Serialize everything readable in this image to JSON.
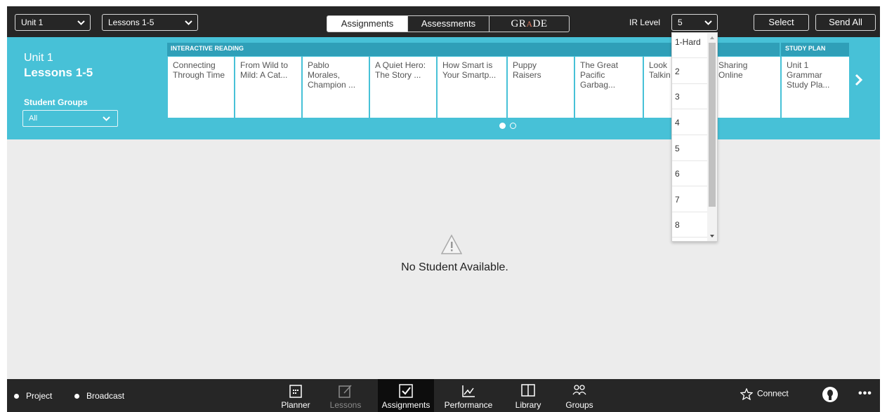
{
  "topbar": {
    "unit_select": "Unit 1",
    "lessons_select": "Lessons 1-5",
    "tabs": {
      "assignments": "Assignments",
      "assessments": "Assessments",
      "grade_pre": "GR",
      "grade_a": "A",
      "grade_post": "DE"
    },
    "ir_label": "IR Level",
    "ir_value": "5",
    "select_button": "Select",
    "send_all_button": "Send All"
  },
  "band": {
    "unit_title": "Unit 1",
    "lessons_title": "Lessons 1-5",
    "student_groups_label": "Student Groups",
    "student_groups_value": "All",
    "section_interactive": "INTERACTIVE READING",
    "section_study_plan": "STUDY PLAN",
    "cards": [
      {
        "l1": "Connecting",
        "l2": "Through Time",
        "l3": ""
      },
      {
        "l1": "From Wild to",
        "l2": "Mild: A Cat...",
        "l3": ""
      },
      {
        "l1": "Pablo",
        "l2": "Morales,",
        "l3": "Champion ..."
      },
      {
        "l1": "A Quiet Hero:",
        "l2": "The Story ...",
        "l3": ""
      },
      {
        "l1": "How Smart is",
        "l2": "Your Smartp...",
        "l3": ""
      },
      {
        "l1": "Puppy",
        "l2": "Raisers",
        "l3": ""
      },
      {
        "l1": "The Great",
        "l2": "Pacific",
        "l3": "Garbag..."
      },
      {
        "l1": "Look",
        "l2": "Talkin",
        "l3": ""
      },
      {
        "l1": "Sharing",
        "l2": "Online",
        "l3": ""
      }
    ],
    "study_plan_card": {
      "l1": "Unit 1",
      "l2": "Grammar",
      "l3": "Study Pla..."
    },
    "pager_count": 2,
    "pager_active": 1
  },
  "empty_state": {
    "text": "No Student Available."
  },
  "ir_dropdown": {
    "options": [
      "1-Hard",
      "2",
      "3",
      "4",
      "5",
      "6",
      "7",
      "8"
    ]
  },
  "bottombar": {
    "project": "Project",
    "broadcast": "Broadcast",
    "nav": [
      "Planner",
      "Lessons",
      "Assignments",
      "Performance",
      "Library",
      "Groups"
    ],
    "connect": "Connect"
  },
  "colors": {
    "band": "#47c1d7",
    "band_dark": "#2f9fb8",
    "bar": "#262626"
  }
}
